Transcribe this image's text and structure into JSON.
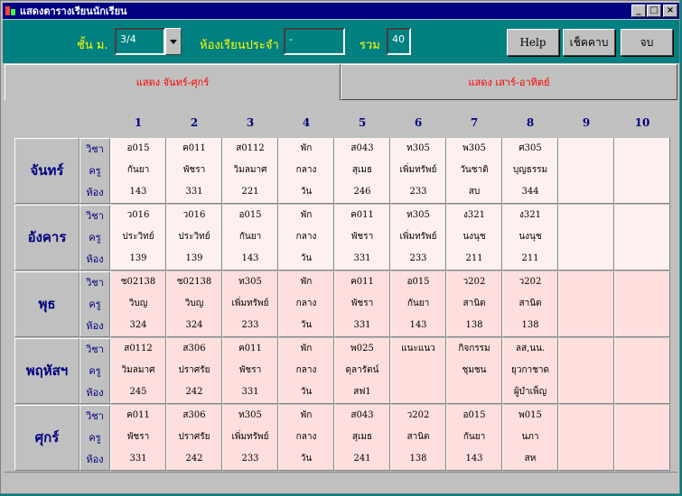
{
  "window": {
    "title": "แสดงตารางเรียนนักเรียน"
  },
  "toolbar": {
    "class_label": "ชั้น ม.",
    "class_value": "3/4",
    "homeroom_label": "ห้องเรียนประจำ",
    "homeroom_value": "-",
    "total_label": "รวม",
    "total_value": "40",
    "help_label": "Help",
    "check_label": "เช็คคาบ",
    "exit_label": "จบ"
  },
  "tabs": [
    "แสดง จันทร์-ศุกร์",
    "แสดง เสาร์-อาทิตย์"
  ],
  "periods": [
    "1",
    "2",
    "3",
    "4",
    "5",
    "6",
    "7",
    "8",
    "9",
    "10"
  ],
  "row_labels": [
    "วิชา",
    "ครู",
    "ห้อง"
  ],
  "colors": {
    "cell_light": "#fff0f0",
    "cell_dark": "#ffdede",
    "header_text": "#000080",
    "tab_text": "#ff0000"
  },
  "days": [
    {
      "name": "จันทร์",
      "cells": [
        [
          "อ015",
          "กันยา",
          "143"
        ],
        [
          "ค011",
          "พัชรา",
          "331"
        ],
        [
          "ส0112",
          "วิมลมาศ",
          "221"
        ],
        [
          "พัก",
          "กลาง",
          "วัน"
        ],
        [
          "ส043",
          "สุเมธ",
          "246"
        ],
        [
          "ท305",
          "เพิ่มทรัพย์",
          "233"
        ],
        [
          "พ305",
          "วันชาติ",
          "สบ"
        ],
        [
          "ศ305",
          "บุญธรรม",
          "344"
        ],
        [
          "",
          "",
          ""
        ],
        [
          "",
          "",
          ""
        ]
      ]
    },
    {
      "name": "อังคาร",
      "cells": [
        [
          "ว016",
          "ประวิทย์",
          "139"
        ],
        [
          "ว016",
          "ประวิทย์",
          "139"
        ],
        [
          "อ015",
          "กันยา",
          "143"
        ],
        [
          "พัก",
          "กลาง",
          "วัน"
        ],
        [
          "ค011",
          "พัชรา",
          "331"
        ],
        [
          "ท305",
          "เพิ่มทรัพย์",
          "233"
        ],
        [
          "ง321",
          "นงนุช",
          "211"
        ],
        [
          "ง321",
          "นงนุช",
          "211"
        ],
        [
          "",
          "",
          ""
        ],
        [
          "",
          "",
          ""
        ]
      ]
    },
    {
      "name": "พุธ",
      "cells": [
        [
          "ช02138",
          "วิบญ",
          "324"
        ],
        [
          "ช02138",
          "วิบญ",
          "324"
        ],
        [
          "ท305",
          "เพิ่มทรัพย์",
          "233"
        ],
        [
          "พัก",
          "กลาง",
          "วัน"
        ],
        [
          "ค011",
          "พัชรา",
          "331"
        ],
        [
          "อ015",
          "กันยา",
          "143"
        ],
        [
          "ว202",
          "สานิต",
          "138"
        ],
        [
          "ว202",
          "สานิต",
          "138"
        ],
        [
          "",
          "",
          ""
        ],
        [
          "",
          "",
          ""
        ]
      ]
    },
    {
      "name": "พฤหัสฯ",
      "cells": [
        [
          "ส0112",
          "วิมลมาศ",
          "245"
        ],
        [
          "ส306",
          "ปราศรัย",
          "242"
        ],
        [
          "ค011",
          "พัชรา",
          "331"
        ],
        [
          "พัก",
          "กลาง",
          "วัน"
        ],
        [
          "พ025",
          "ดุลารัตน์",
          "สฟ1"
        ],
        [
          "แนะแนว",
          "",
          ""
        ],
        [
          "กิจกรรม",
          "ชุมชน",
          ""
        ],
        [
          "ลส,นน.",
          "ยุวกาชาด",
          "ผู้บำเพ็ญ"
        ],
        [
          "",
          "",
          ""
        ],
        [
          "",
          "",
          ""
        ]
      ]
    },
    {
      "name": "ศุกร์",
      "cells": [
        [
          "ค011",
          "พัชรา",
          "331"
        ],
        [
          "ส306",
          "ปราศรัย",
          "242"
        ],
        [
          "ท305",
          "เพิ่มทรัพย์",
          "233"
        ],
        [
          "พัก",
          "กลาง",
          "วัน"
        ],
        [
          "ส043",
          "สุเมธ",
          "241"
        ],
        [
          "ว202",
          "สานิต",
          "138"
        ],
        [
          "อ015",
          "กันยา",
          "143"
        ],
        [
          "พ015",
          "นภา",
          "สห"
        ],
        [
          "",
          "",
          ""
        ],
        [
          "",
          "",
          ""
        ]
      ]
    }
  ]
}
